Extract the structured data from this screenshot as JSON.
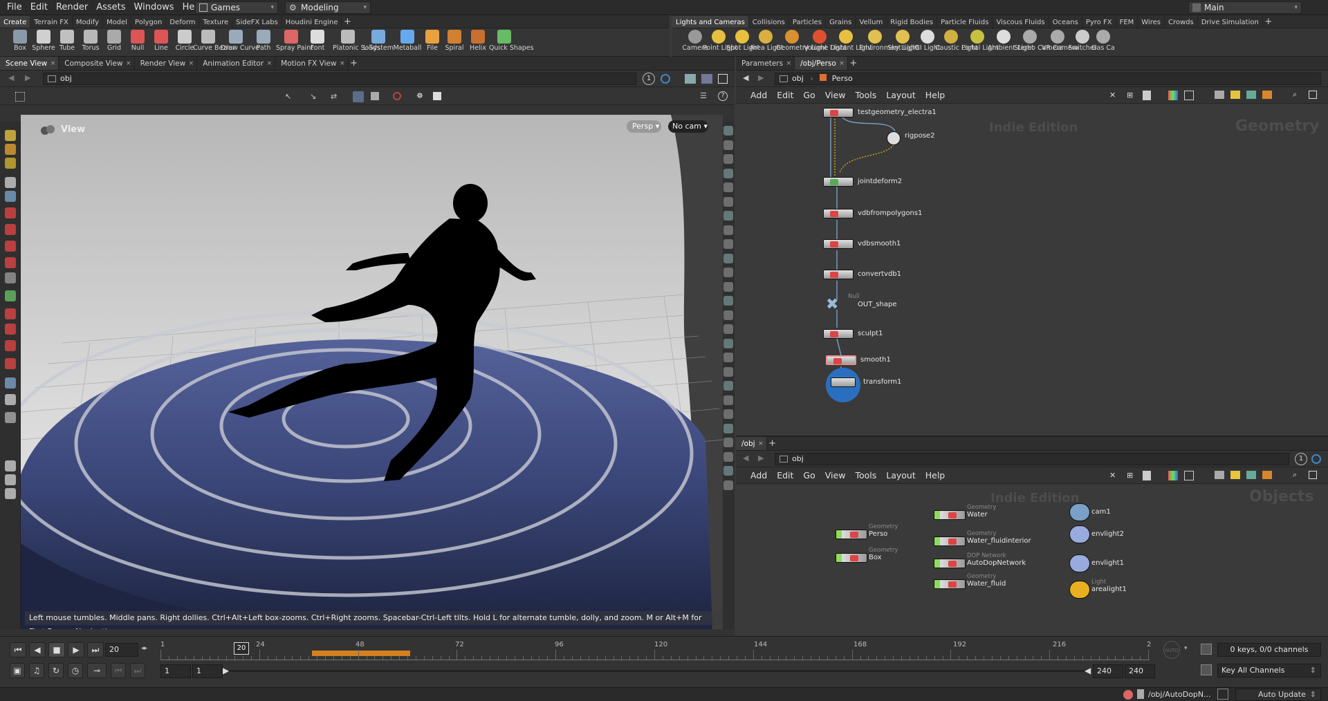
{
  "menubar": {
    "items": [
      "File",
      "Edit",
      "Render",
      "Assets",
      "Windows",
      "Help"
    ],
    "desktop": "Games",
    "workspace": "Modeling",
    "main": "Main"
  },
  "shelf_left": {
    "tabs": [
      "Create",
      "Terrain FX",
      "Modify",
      "Model",
      "Polygon",
      "Deform",
      "Texture",
      "SideFX Labs",
      "Houdini Engine"
    ],
    "tools": [
      "Box",
      "Sphere",
      "Tube",
      "Torus",
      "Grid",
      "Null",
      "Line",
      "Circle",
      "Curve Bezier",
      "Draw Curve",
      "Path",
      "Spray Paint",
      "Font",
      "Platonic Solids",
      "L-System",
      "Metaball",
      "File",
      "Spiral",
      "Helix",
      "Quick Shapes"
    ]
  },
  "shelf_right": {
    "tabs": [
      "Lights and Cameras",
      "Collisions",
      "Particles",
      "Grains",
      "Vellum",
      "Rigid Bodies",
      "Particle Fluids",
      "Viscous Fluids",
      "Oceans",
      "Pyro FX",
      "FEM",
      "Wires",
      "Crowds",
      "Drive Simulation"
    ],
    "tools": [
      "Camera",
      "Point Light",
      "Spot Light",
      "Area Light",
      "Geometry Light",
      "Volume Light",
      "Distant Light",
      "Environment Light",
      "Sky Light",
      "GI Light",
      "Caustic Light",
      "Portal Light",
      "Ambient Light",
      "Stereo Camera",
      "VR Camera",
      "Switcher",
      "Gas Ca"
    ]
  },
  "left_pane": {
    "tabs": [
      "Scene View",
      "Composite View",
      "Render View",
      "Animation Editor",
      "Motion FX View"
    ],
    "path": "obj",
    "view_title": "View",
    "persp_label": "Persp",
    "cam_label": "No cam",
    "status_hint": "Left mouse tumbles. Middle pans. Right dollies. Ctrl+Alt+Left box-zooms. Ctrl+Right zooms. Spacebar-Ctrl-Left tilts. Hold L for alternate tumble, dolly, and zoom.  M or Alt+M for First Person Navigation.",
    "page_num": "1"
  },
  "top_network": {
    "tabs": [
      "Parameters",
      "/obj/Perso"
    ],
    "path_root": "obj",
    "path_child": "Perso",
    "menu": [
      "Add",
      "Edit",
      "Go",
      "View",
      "Tools",
      "Layout",
      "Help"
    ],
    "watermark_edition": "Indie Edition",
    "watermark_context": "Geometry",
    "nodes": [
      {
        "name": "testgeometry_electra1",
        "type": ""
      },
      {
        "name": "rigpose2",
        "type": ""
      },
      {
        "name": "jointdeform2",
        "type": ""
      },
      {
        "name": "vdbfrompolygons1",
        "type": ""
      },
      {
        "name": "vdbsmooth1",
        "type": ""
      },
      {
        "name": "convertvdb1",
        "type": ""
      },
      {
        "name": "OUT_shape",
        "type": "Null"
      },
      {
        "name": "sculpt1",
        "type": ""
      },
      {
        "name": "smooth1",
        "type": ""
      },
      {
        "name": "transform1",
        "type": ""
      }
    ]
  },
  "bottom_network": {
    "tabs": [
      "/obj"
    ],
    "path_root": "obj",
    "menu": [
      "Add",
      "Edit",
      "Go",
      "View",
      "Tools",
      "Layout",
      "Help"
    ],
    "watermark_edition": "Indie Edition",
    "watermark_context": "Objects",
    "page_num": "1",
    "nodes": [
      {
        "name": "Perso",
        "type": "Geometry"
      },
      {
        "name": "Box",
        "type": "Geometry"
      },
      {
        "name": "Water",
        "type": "Geometry"
      },
      {
        "name": "Water_fluidinterior",
        "type": "Geometry"
      },
      {
        "name": "AutoDopNetwork",
        "type": "DOP Network"
      },
      {
        "name": "Water_fluid",
        "type": "Geometry"
      },
      {
        "name": "cam1",
        "type": ""
      },
      {
        "name": "envlight2",
        "type": ""
      },
      {
        "name": "envlight1",
        "type": ""
      },
      {
        "name": "arealight1",
        "type": "Light"
      }
    ]
  },
  "timeline": {
    "current_frame": "20",
    "frame_marker": "20",
    "ticks": [
      "1",
      "24",
      "48",
      "72",
      "96",
      "120",
      "144",
      "168",
      "192",
      "216",
      "2"
    ],
    "range_start": "1",
    "range_start2": "1",
    "range_end": "240",
    "range_end2": "240",
    "keys_info": "0 keys, 0/0 channels",
    "key_mode": "Key All Channels",
    "auto_label": "AUTO"
  },
  "statusbar": {
    "path": "/obj/AutoDopN...",
    "update_mode": "Auto Update"
  },
  "colors": {
    "water": "#3c4a7e",
    "node_red": "#d44",
    "selection_blue": "#2a6fbf"
  }
}
